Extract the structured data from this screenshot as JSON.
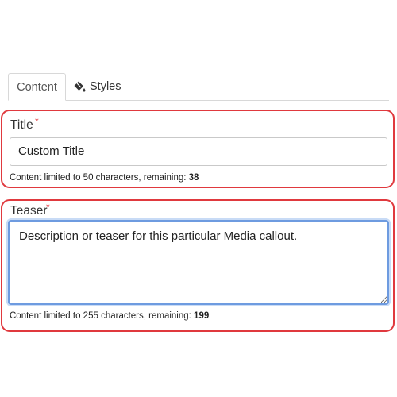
{
  "tabs": [
    {
      "label": "Content",
      "active": true
    },
    {
      "label": "Styles",
      "icon": "paint-bucket-icon",
      "active": false
    }
  ],
  "title_field": {
    "label": "Title",
    "required_mark": "*",
    "value": "Custom Title",
    "helper_text": "Content limited to 50 characters, remaining: ",
    "remaining": "38"
  },
  "teaser_field": {
    "label": "Teaser",
    "required_mark": "*",
    "value": "Description or teaser for this particular Media callout.",
    "helper_text": "Content limited to 255 characters, remaining: ",
    "remaining": "199"
  },
  "colors": {
    "highlight_border": "#e0393e",
    "focus_border": "#6e9be0",
    "required_mark": "#e0393e"
  }
}
